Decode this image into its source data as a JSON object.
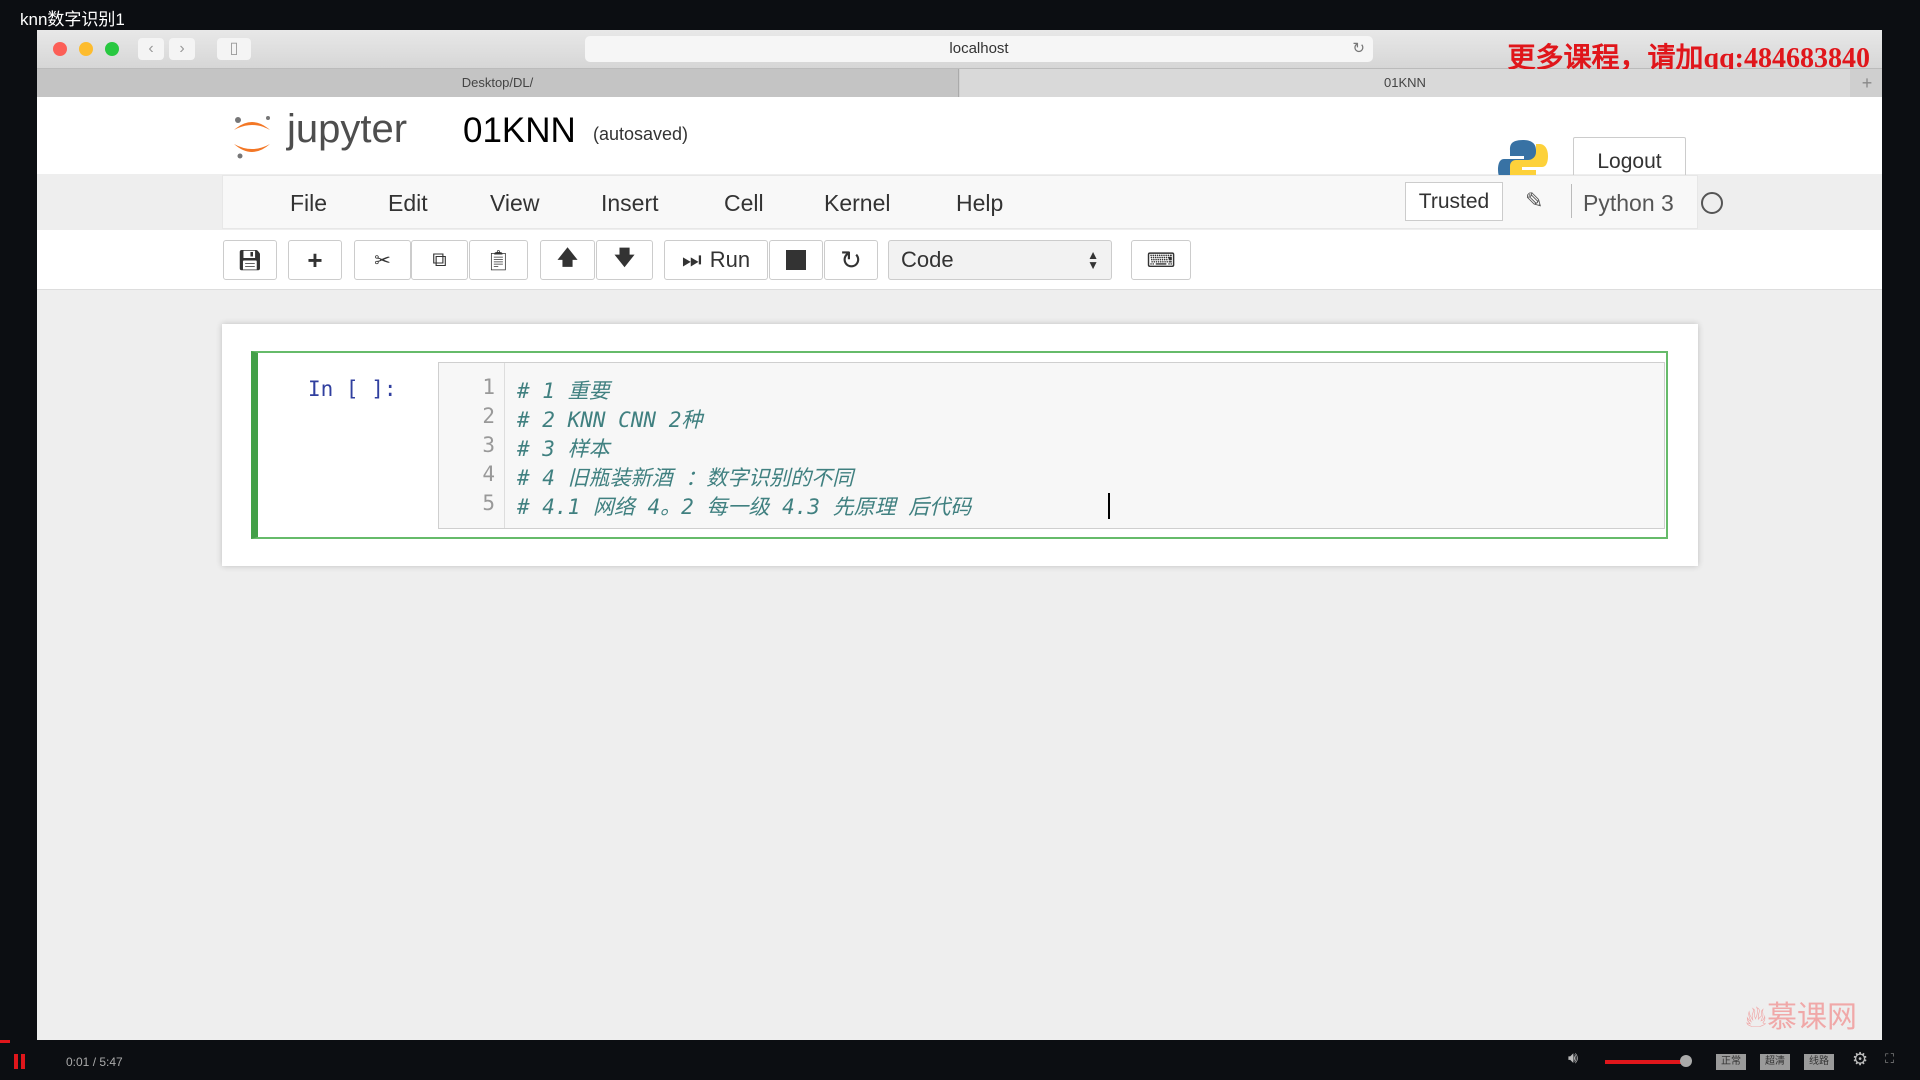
{
  "window_title": "knn数字识别1",
  "browser": {
    "url": "localhost",
    "promo": "更多课程，请加qq:484683840",
    "tabs": [
      "Desktop/DL/",
      "01KNN"
    ]
  },
  "header": {
    "logo_text": "jupyter",
    "notebook_name": "01KNN",
    "status": "(autosaved)",
    "logout": "Logout"
  },
  "menu": {
    "items": [
      "File",
      "Edit",
      "View",
      "Insert",
      "Cell",
      "Kernel",
      "Help"
    ],
    "trusted": "Trusted",
    "kernel": "Python 3"
  },
  "toolbar": {
    "run": "Run",
    "cell_type": "Code"
  },
  "cell": {
    "prompt": "In [ ]:",
    "lines": [
      "# 1 重要",
      "# 2 KNN CNN 2种",
      "# 3 样本",
      "# 4 旧瓶装新酒 ：数字识别的不同",
      "# 4.1 网络 4。2 每一级 4.3 先原理 后代码 "
    ],
    "line_numbers": [
      "1",
      "2",
      "3",
      "4",
      "5"
    ]
  },
  "watermark": "慕课网",
  "player": {
    "time": "0:01 / 5:47",
    "buttons": [
      "正常",
      "超清",
      "线路"
    ],
    "volume_percent": 100
  },
  "colors": {
    "accent_green": "#42a047",
    "promo_red": "#e0161b",
    "comment": "#408080"
  }
}
